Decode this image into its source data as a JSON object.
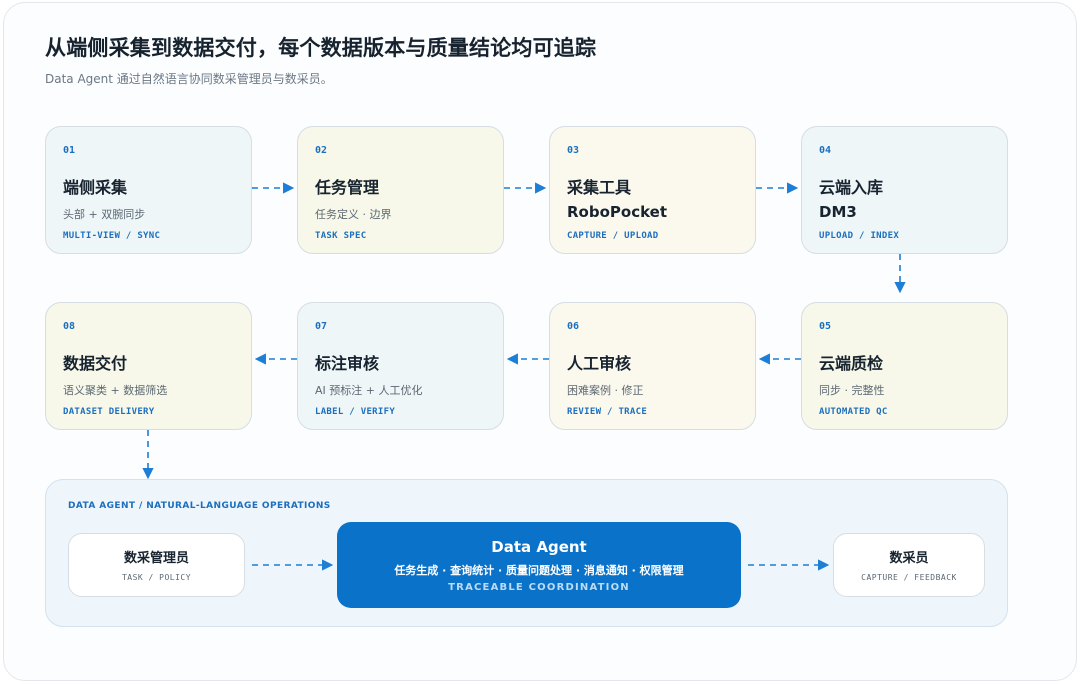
{
  "header": {
    "title": "从端侧采集到数据交付，每个数据版本与质量结论均可追踪",
    "subtitle": "Data Agent 通过自然语言协同数采管理员与数采员。"
  },
  "steps": [
    {
      "num": "01",
      "name": "端侧采集",
      "desc": "头部 + 双腕同步",
      "tag": "MULTI-VIEW / SYNC"
    },
    {
      "num": "02",
      "name": "任务管理",
      "desc": "任务定义 · 边界",
      "tag": "TASK SPEC"
    },
    {
      "num": "03",
      "name": "采集工具",
      "desc": "RoboPocket",
      "tag": "CAPTURE / UPLOAD"
    },
    {
      "num": "04",
      "name": "云端入库",
      "desc": "DM3",
      "tag": "UPLOAD / INDEX"
    },
    {
      "num": "05",
      "name": "云端质检",
      "desc": "同步 · 完整性",
      "tag": "AUTOMATED QC"
    },
    {
      "num": "06",
      "name": "人工审核",
      "desc": "困难案例 · 修正",
      "tag": "REVIEW / TRACE"
    },
    {
      "num": "07",
      "name": "标注审核",
      "desc": "AI 预标注 + 人工优化",
      "tag": "LABEL / VERIFY"
    },
    {
      "num": "08",
      "name": "数据交付",
      "desc": "语义聚类 + 数据筛选",
      "tag": "DATASET DELIVERY"
    }
  ],
  "agent_panel": {
    "label": "DATA AGENT / NATURAL-LANGUAGE OPERATIONS",
    "admin": {
      "name": "数采管理员",
      "tag": "TASK / POLICY"
    },
    "agent": {
      "name": "Data Agent",
      "desc": "任务生成 · 查询统计 · 质量问题处理 · 消息通知 · 权限管理",
      "tag": "TRACEABLE COORDINATION"
    },
    "collector": {
      "name": "数采员",
      "tag": "CAPTURE / FEEDBACK"
    }
  },
  "colors": {
    "accent": "#0a72c9",
    "connector": "#1c7ed6",
    "card_blue": "#eef6f8",
    "card_yellow": "#f7f8e9",
    "card_cream": "#fbf8ee"
  }
}
